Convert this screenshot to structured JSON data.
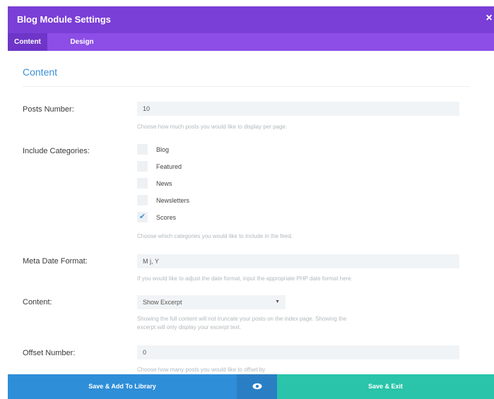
{
  "modal": {
    "title": "Blog Module Settings",
    "close_glyph": "×",
    "close_icon": "close-icon"
  },
  "tabs": [
    {
      "label": "Content",
      "active": true
    },
    {
      "label": "Design",
      "active": false
    }
  ],
  "section": {
    "title": "Content"
  },
  "fields": {
    "posts_number": {
      "label": "Posts Number:",
      "value": "10",
      "help": "Choose how much posts you would like to display per page."
    },
    "include_categories": {
      "label": "Include Categories:",
      "options": [
        {
          "label": "Blog",
          "checked": false
        },
        {
          "label": "Featured",
          "checked": false
        },
        {
          "label": "News",
          "checked": false
        },
        {
          "label": "Newsletters",
          "checked": false
        },
        {
          "label": "Scores",
          "checked": true
        }
      ],
      "check_glyph": "✔",
      "help": "Choose which categories you would like to include in the feed."
    },
    "meta_date_format": {
      "label": "Meta Date Format:",
      "value": "M j, Y",
      "help": "If you would like to adjust the date format, input the appropriate PHP date format here."
    },
    "content": {
      "label": "Content:",
      "value": "Show Excerpt",
      "arrow_glyph": "▼",
      "help_line1": "Showing the full content will not truncate your posts on the index page. Showing the",
      "help_line2": "excerpt will only display your excerpt text."
    },
    "offset_number": {
      "label": "Offset Number:",
      "value": "0",
      "help": "Choose how many posts you would like to offset by"
    }
  },
  "footer": {
    "save_library_label": "Save & Add To Library",
    "preview_icon": "eye-icon",
    "save_exit_label": "Save & Exit"
  },
  "colors": {
    "header": "#7a3fd6",
    "tabs_bar": "#8c4ee6",
    "tab_active": "#6e35c8",
    "accent_blue": "#3b8fd6",
    "library_button": "#2e8ed8",
    "preview_button": "#2a7fc4",
    "exit_button": "#29c4a9"
  }
}
